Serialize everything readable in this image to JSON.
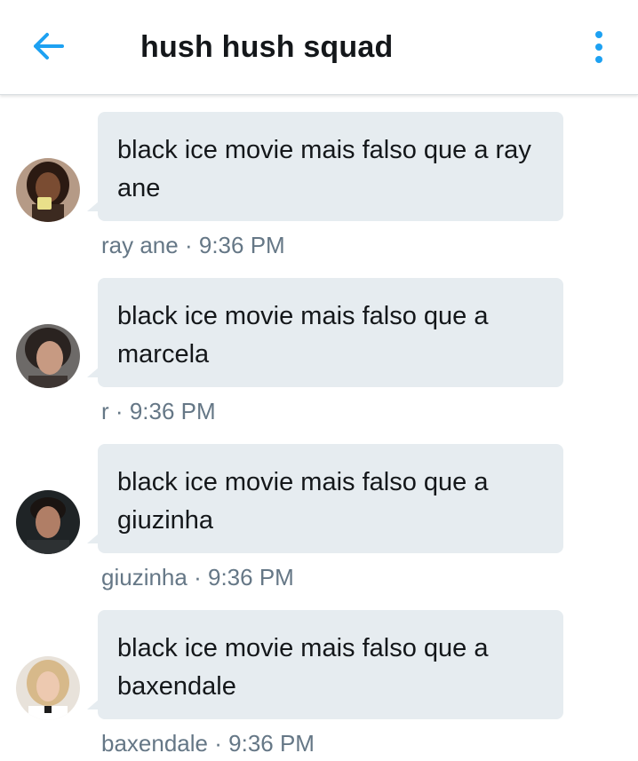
{
  "header": {
    "title": "hush hush squad",
    "back_icon": "arrow-left-icon",
    "menu_icon": "more-vertical-icon",
    "accent_color": "#1da1f2"
  },
  "messages": [
    {
      "text": "black ice movie mais falso que a ray ane",
      "sender": "ray ane",
      "time": "9:36 PM"
    },
    {
      "text": "black ice movie mais falso que a marcela",
      "sender": "r",
      "time": "9:36 PM"
    },
    {
      "text": "black ice movie mais falso que a giuzinha",
      "sender": "giuzinha",
      "time": "9:36 PM"
    },
    {
      "text": "black ice movie mais falso que a baxendale",
      "sender": "baxendale",
      "time": "9:36 PM"
    }
  ],
  "separator": "·",
  "colors": {
    "bubble": "#e6ecf0",
    "text": "#14171a",
    "meta": "#657786"
  }
}
